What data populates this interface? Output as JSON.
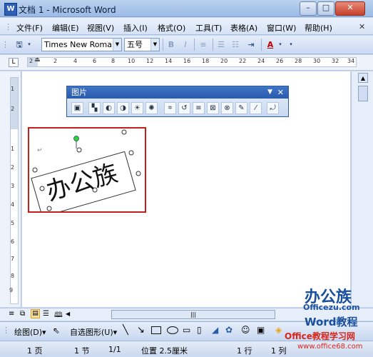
{
  "window": {
    "title": "文档 1 - Microsoft Word",
    "min": "–",
    "max": "□",
    "close": "✕"
  },
  "menu": [
    "文件(F)",
    "编辑(E)",
    "视图(V)",
    "插入(I)",
    "格式(O)",
    "工具(T)",
    "表格(A)",
    "窗口(W)",
    "帮助(H)"
  ],
  "toolbar": {
    "font": "Times New Roman",
    "size": "五号",
    "bold": "B",
    "italic": "I"
  },
  "ruler": {
    "corner": "L",
    "ticks": [
      "2",
      "2",
      "4",
      "6",
      "8",
      "10",
      "12",
      "14",
      "16",
      "18",
      "20",
      "22",
      "24",
      "26",
      "28",
      "30",
      "32",
      "34"
    ]
  },
  "vruler_ticks": [
    "1",
    "2",
    "1",
    "2",
    "3",
    "4",
    "5",
    "6",
    "7",
    "8",
    "9",
    "10",
    "11",
    "12"
  ],
  "picture_toolbar": {
    "title": "图片",
    "close": "✕"
  },
  "document": {
    "paragraph_mark": "↵",
    "picture_text": "办公族"
  },
  "drawing_toolbar": {
    "draw": "绘图(D)▾",
    "autoshapes": "自选图形(U)▾"
  },
  "status": {
    "page": "1 页",
    "section": "1 节",
    "pages": "1/1",
    "position": "位置 2.5厘米",
    "line": "1 行",
    "column": "1 列"
  },
  "watermark": {
    "brand": "办公族",
    "site1": "Officezu.com",
    "word": "Word教程",
    "site2": "Office教程学习网",
    "site3": "www.office68.com"
  }
}
